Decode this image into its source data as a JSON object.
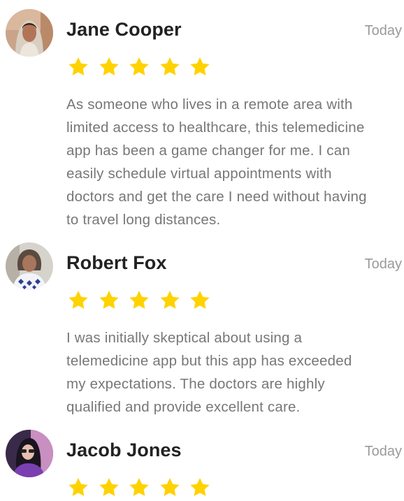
{
  "reviews": [
    {
      "name": "Jane Cooper",
      "date": "Today",
      "rating": 5,
      "lines": [
        "As someone who lives in a remote area with",
        "limited access to healthcare, this telemedicine",
        "app has been a game changer for me. I can",
        "easily schedule virtual appointments with",
        "doctors and get the care I need without having",
        "to travel long distances."
      ]
    },
    {
      "name": "Robert Fox",
      "date": "Today",
      "rating": 5,
      "lines": [
        "I was initially skeptical about using a",
        "telemedicine app but this app has exceeded",
        "my expectations. The doctors are highly",
        "qualified and provide excellent care."
      ]
    },
    {
      "name": "Jacob Jones",
      "date": "Today",
      "rating": 5,
      "lines": []
    }
  ],
  "colors": {
    "star": "#FFD200",
    "name": "#222222",
    "date": "#9A9A9A",
    "body": "#777777"
  },
  "icons": {
    "rating": "star-icon"
  }
}
